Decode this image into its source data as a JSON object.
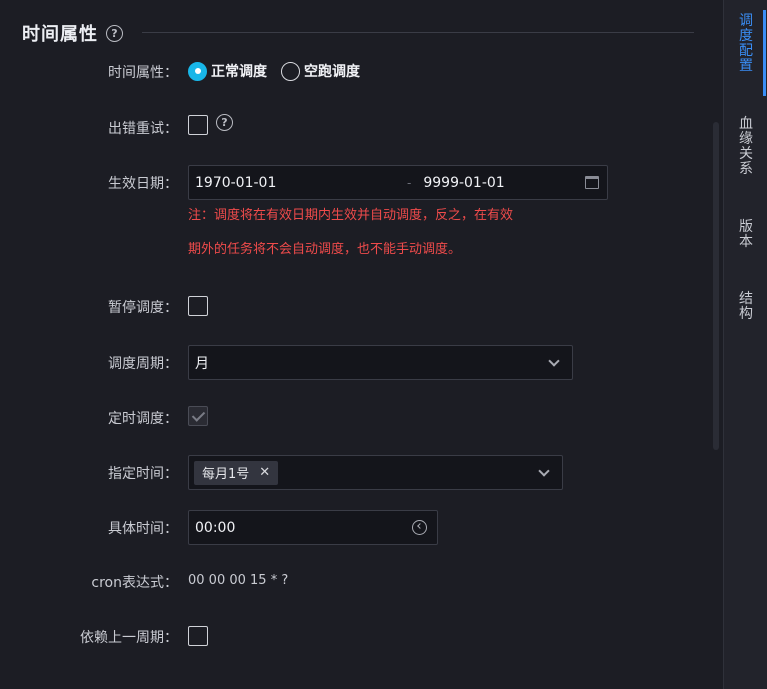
{
  "section": {
    "title": "时间属性",
    "help_glyph": "?"
  },
  "fields": {
    "time_attr": {
      "label": "时间属性：",
      "options": [
        "正常调度",
        "空跑调度"
      ],
      "selected": "正常调度"
    },
    "retry": {
      "label": "出错重试：",
      "help_glyph": "?"
    },
    "effective_date": {
      "label": "生效日期：",
      "start": "1970-01-01",
      "separator": "-",
      "end": "9999-01-01"
    },
    "note": {
      "line1": "注：调度将在有效日期内生效并自动调度，反之，在有效",
      "line2": "期外的任务将不会自动调度，也不能手动调度。"
    },
    "pause": {
      "label": "暂停调度："
    },
    "period": {
      "label": "调度周期：",
      "value": "月"
    },
    "timed": {
      "label": "定时调度：",
      "checked": true
    },
    "specified_time": {
      "label": "指定时间：",
      "tag": "每月1号",
      "tag_close": "✕"
    },
    "specific_time": {
      "label": "具体时间：",
      "value": "00:00"
    },
    "cron": {
      "label": "cron表达式：",
      "value": "00 00 00 15 * ?"
    },
    "depend_prev": {
      "label": "依赖上一周期："
    }
  },
  "sidebar": {
    "items": [
      {
        "label_chars": [
          "调",
          "度",
          "配",
          "置"
        ],
        "active": true
      },
      {
        "label_chars": [
          "血",
          "缘",
          "关",
          "系"
        ],
        "active": false
      },
      {
        "label_chars": [
          "版",
          "本"
        ],
        "active": false
      },
      {
        "label_chars": [
          "结",
          "构"
        ],
        "active": false
      }
    ]
  },
  "colors": {
    "accent": "#3a8ef6",
    "radio": "#18b6e8",
    "warning": "#ef4b4b",
    "background": "#1c1d24"
  }
}
